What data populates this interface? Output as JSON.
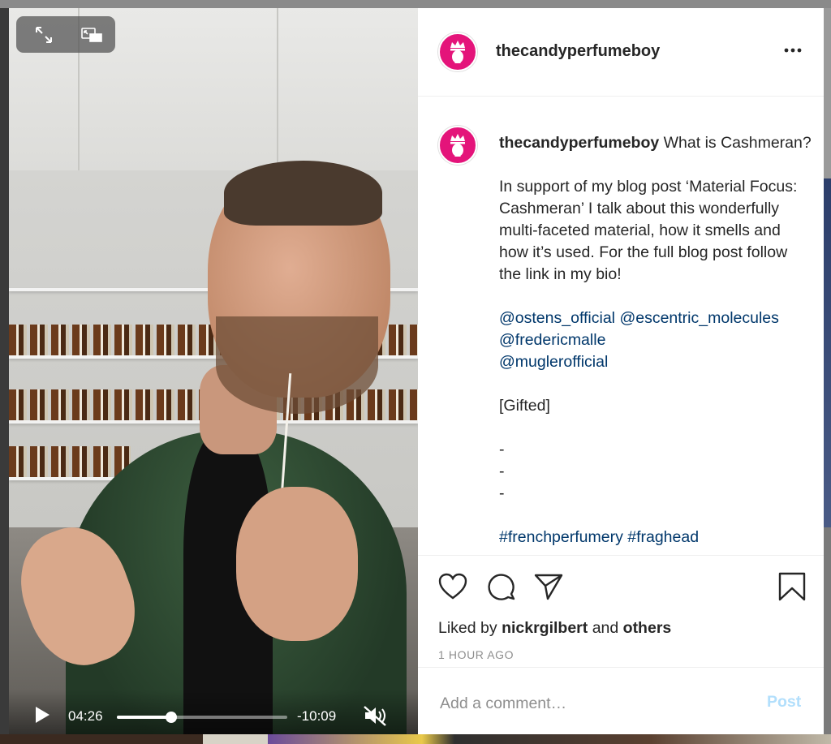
{
  "video": {
    "elapsed": "04:26",
    "remaining": "-10:09",
    "progress_fraction": 0.32
  },
  "post": {
    "username": "thecandyperfumeboy",
    "caption_title": "What is Cashmeran?",
    "caption_body": "In support of my blog post ‘Material Focus: Cashmeran’ I talk about this wonderfully multi-faceted material, how it smells and how it’s used. For the full blog post follow the link in my bio!",
    "mentions": [
      "@ostens_official",
      "@escentric_molecules",
      "@fredericmalle",
      "@muglerofficial"
    ],
    "gifted": "[Gifted]",
    "dashes": [
      "-",
      "-",
      "-"
    ],
    "hashtags_partial": "#frenchperfumery #fraghead",
    "liked_prefix": "Liked by",
    "liked_user": "nickrgilbert",
    "liked_and": "and",
    "liked_others": "others",
    "time_ago": "1 HOUR AGO"
  },
  "comment": {
    "placeholder": "Add a comment…",
    "post_label": "Post"
  },
  "colors": {
    "avatar": "#e4147a",
    "mention": "#00376b",
    "post_disabled": "#b2dffc"
  },
  "icons": [
    "expand-icon",
    "picture-in-picture-icon",
    "play-icon",
    "mute-icon",
    "more-icon",
    "heart-icon",
    "comment-icon",
    "share-icon",
    "bookmark-icon"
  ]
}
